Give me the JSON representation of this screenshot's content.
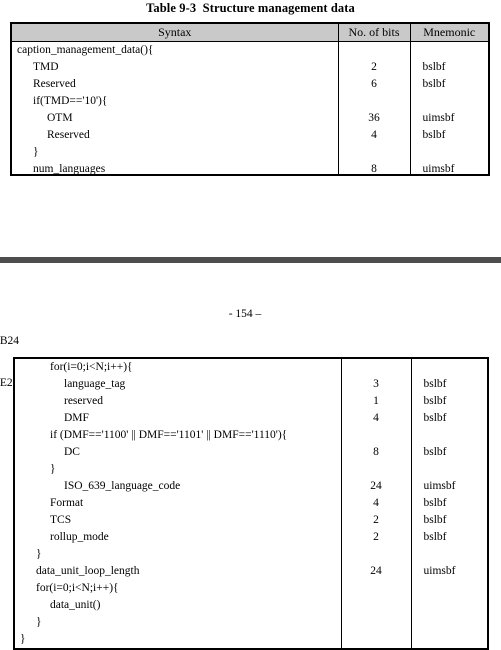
{
  "document": {
    "caption": "Table 9-3  Structure management data",
    "page_number_text": "- 154 –",
    "footer_left_lines": [
      "-B24",
      "-E2"
    ],
    "separator_color": "#4d4d4d",
    "header_fill": "#c9c9c9"
  },
  "table_top": {
    "columns": [
      "Syntax",
      "No. of bits",
      "Mnemonic"
    ],
    "rows": [
      {
        "syntax": "caption_management_data(){",
        "indent": 0,
        "bits": "",
        "mnemonic": ""
      },
      {
        "syntax": "TMD",
        "indent": 1,
        "bits": "2",
        "mnemonic": "bslbf"
      },
      {
        "syntax": "Reserved",
        "indent": 1,
        "bits": "6",
        "mnemonic": "bslbf"
      },
      {
        "syntax": "if(TMD=='10'){",
        "indent": 1,
        "bits": "",
        "mnemonic": ""
      },
      {
        "syntax": "OTM",
        "indent": 2,
        "bits": "36",
        "mnemonic": "uimsbf"
      },
      {
        "syntax": "Reserved",
        "indent": 2,
        "bits": "4",
        "mnemonic": "bslbf"
      },
      {
        "syntax": "}",
        "indent": 1,
        "bits": "",
        "mnemonic": ""
      },
      {
        "syntax": "num_languages",
        "indent": 1,
        "bits": "8",
        "mnemonic": "uimsbf"
      }
    ]
  },
  "table_bottom": {
    "rows": [
      {
        "syntax": "for(i=0;i<N;i++){",
        "indent": 1,
        "bits": "",
        "mnemonic": ""
      },
      {
        "syntax": "language_tag",
        "indent": 2,
        "bits": "3",
        "mnemonic": "bslbf"
      },
      {
        "syntax": "reserved",
        "indent": 2,
        "bits": "1",
        "mnemonic": "bslbf"
      },
      {
        "syntax": "DMF",
        "indent": 2,
        "bits": "4",
        "mnemonic": "bslbf"
      },
      {
        "syntax": "if (DMF=='1100' || DMF=='1101' || DMF=='1110'){",
        "indent": 1,
        "bits": "",
        "mnemonic": ""
      },
      {
        "syntax": "DC",
        "indent": 2,
        "bits": "8",
        "mnemonic": "bslbf"
      },
      {
        "syntax": "}",
        "indent": 1,
        "bits": "",
        "mnemonic": ""
      },
      {
        "syntax": "ISO_639_language_code",
        "indent": 2,
        "bits": "24",
        "mnemonic": "uimsbf"
      },
      {
        "syntax": "Format",
        "indent": 1,
        "bits": "4",
        "mnemonic": "bslbf"
      },
      {
        "syntax": "TCS",
        "indent": 1,
        "bits": "2",
        "mnemonic": "bslbf"
      },
      {
        "syntax": "rollup_mode",
        "indent": 1,
        "bits": "2",
        "mnemonic": "bslbf"
      },
      {
        "syntax": "}",
        "indent": 1,
        "bits": "",
        "mnemonic": ""
      },
      {
        "syntax": "data_unit_loop_length",
        "indent": 0,
        "bits": "24",
        "mnemonic": "uimsbf"
      },
      {
        "syntax": "for(i=0;i<N;i++){",
        "indent": 0,
        "bits": "",
        "mnemonic": ""
      },
      {
        "syntax": "data_unit()",
        "indent": 1,
        "bits": "",
        "mnemonic": ""
      },
      {
        "syntax": "}",
        "indent": 0,
        "bits": "",
        "mnemonic": ""
      },
      {
        "syntax": "}",
        "indent": -1,
        "bits": "",
        "mnemonic": ""
      }
    ]
  }
}
